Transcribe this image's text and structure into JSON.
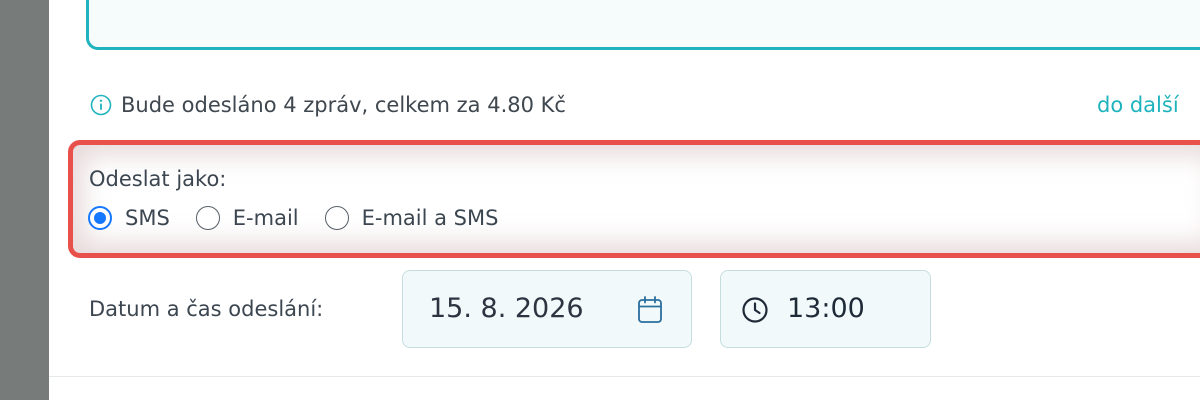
{
  "info": {
    "message": "Bude odesláno 4 zpráv, celkem za 4.80 Kč",
    "next_link": "do další"
  },
  "send_as": {
    "label": "Odeslat jako:",
    "options": [
      {
        "label": "SMS",
        "selected": true
      },
      {
        "label": "E-mail",
        "selected": false
      },
      {
        "label": "E-mail a SMS",
        "selected": false
      }
    ]
  },
  "schedule": {
    "label": "Datum a čas odeslání:",
    "date": "15. 8. 2026",
    "time": "13:00"
  },
  "colors": {
    "accent": "#1fb3bd",
    "highlight": "#e8514b",
    "radio_selected": "#1677ff"
  },
  "icons": {
    "info": "info-icon",
    "calendar": "calendar-icon",
    "clock": "clock-icon"
  }
}
